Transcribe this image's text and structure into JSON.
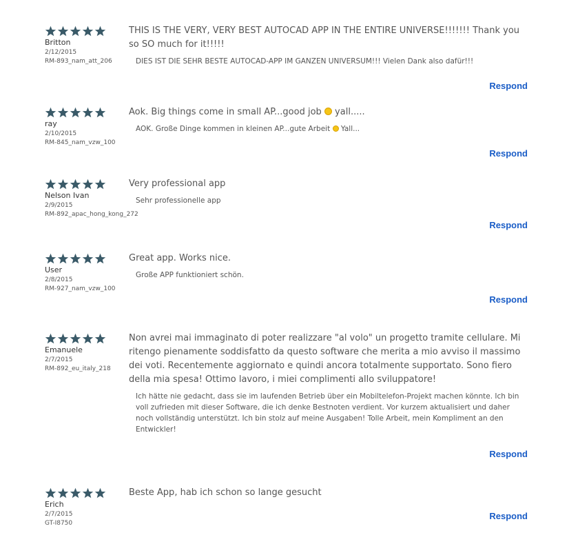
{
  "colors": {
    "star": "#3a5a68",
    "respond": "#1a5dc7",
    "text": "#555555"
  },
  "icons": {
    "star": "star-icon",
    "emoji": "smiley-icon"
  },
  "respond_label": "Respond",
  "reviews": [
    {
      "rating": 5,
      "author": "Britton",
      "date": "2/12/2015",
      "device": "RM-893_nam_att_206",
      "text": "THIS IS THE VERY, VERY BEST AUTOCAD APP IN THE ENTIRE UNIVERSE!!!!!!! Thank you so SO much for it!!!!!",
      "translation": "DIES IST DIE SEHR BESTE AUTOCAD-APP IM GANZEN UNIVERSUM!!! Vielen Dank also dafür!!!"
    },
    {
      "rating": 5,
      "author": "ray",
      "date": "2/10/2015",
      "device": "RM-845_nam_vzw_100",
      "text_before": "Aok. Big things come in small AP...good job",
      "text_after": " yall.....",
      "translation_before": "AOK. Große Dinge kommen in kleinen AP...gute Arbeit",
      "translation_after": " Yall..."
    },
    {
      "rating": 5,
      "author": "Nelson Ivan",
      "date": "2/9/2015",
      "device": "RM-892_apac_hong_kong_272",
      "text": "Very professional app",
      "translation": "Sehr professionelle app"
    },
    {
      "rating": 5,
      "author": "User",
      "date": "2/8/2015",
      "device": "RM-927_nam_vzw_100",
      "text": "Great app. Works nice.",
      "translation": "Große APP funktioniert schön."
    },
    {
      "rating": 5,
      "author": "Emanuele",
      "date": "2/7/2015",
      "device": "RM-892_eu_italy_218",
      "text": "Non avrei mai immaginato di poter realizzare \"al volo\" un progetto tramite cellulare. Mi ritengo pienamente soddisfatto da questo software che merita a mio avviso il massimo dei voti. Recentemente aggiornato e quindi ancora totalmente supportato. Sono fiero della mia spesa! Ottimo lavoro, i miei complimenti allo sviluppatore!",
      "translation": "Ich hätte nie gedacht, dass sie im laufenden Betrieb über ein Mobiltelefon-Projekt machen könnte. Ich bin voll zufrieden mit dieser Software, die ich denke Bestnoten verdient. Vor kurzem aktualisiert und daher noch vollständig unterstützt. Ich bin stolz auf meine Ausgaben! Tolle Arbeit, mein Kompliment an den Entwickler!"
    },
    {
      "rating": 5,
      "author": "Erich",
      "date": "2/7/2015",
      "device": "GT-I8750",
      "text": "Beste App, hab ich schon so lange gesucht"
    }
  ]
}
